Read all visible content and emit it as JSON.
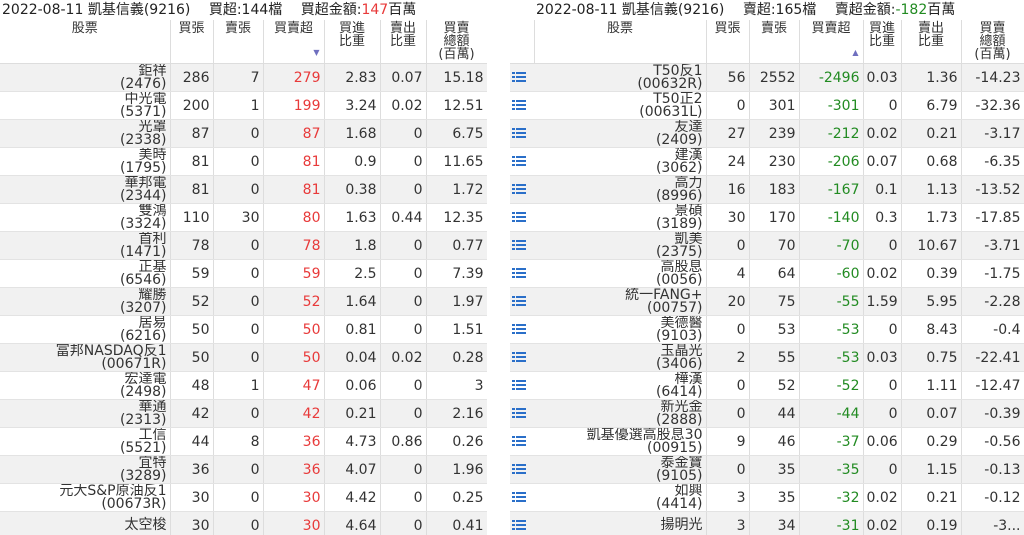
{
  "left": {
    "date": "2022-08-11",
    "broker": "凱基信義(9216)",
    "count_label": "買超:144檔",
    "amount_prefix": "買超金額:",
    "amount_value": "147",
    "amount_unit": "百萬",
    "headers": [
      "股票",
      "買張",
      "賣張",
      "買賣超",
      "買進\n比重",
      "賣出\n比重",
      "買賣\n總額\n(百萬)"
    ],
    "sort_indicator": "▼",
    "rows": [
      {
        "name": "鉅祥",
        "code": "(2476)",
        "buy": "286",
        "sell": "7",
        "net": "279",
        "buy_ratio": "2.83",
        "sell_ratio": "0.07",
        "total": "15.18"
      },
      {
        "name": "中光電",
        "code": "(5371)",
        "buy": "200",
        "sell": "1",
        "net": "199",
        "buy_ratio": "3.24",
        "sell_ratio": "0.02",
        "total": "12.51"
      },
      {
        "name": "光罩",
        "code": "(2338)",
        "buy": "87",
        "sell": "0",
        "net": "87",
        "buy_ratio": "1.68",
        "sell_ratio": "0",
        "total": "6.75"
      },
      {
        "name": "美時",
        "code": "(1795)",
        "buy": "81",
        "sell": "0",
        "net": "81",
        "buy_ratio": "0.9",
        "sell_ratio": "0",
        "total": "11.65"
      },
      {
        "name": "華邦電",
        "code": "(2344)",
        "buy": "81",
        "sell": "0",
        "net": "81",
        "buy_ratio": "0.38",
        "sell_ratio": "0",
        "total": "1.72"
      },
      {
        "name": "雙鴻",
        "code": "(3324)",
        "buy": "110",
        "sell": "30",
        "net": "80",
        "buy_ratio": "1.63",
        "sell_ratio": "0.44",
        "total": "12.35"
      },
      {
        "name": "首利",
        "code": "(1471)",
        "buy": "78",
        "sell": "0",
        "net": "78",
        "buy_ratio": "1.8",
        "sell_ratio": "0",
        "total": "0.77"
      },
      {
        "name": "正基",
        "code": "(6546)",
        "buy": "59",
        "sell": "0",
        "net": "59",
        "buy_ratio": "2.5",
        "sell_ratio": "0",
        "total": "7.39"
      },
      {
        "name": "耀勝",
        "code": "(3207)",
        "buy": "52",
        "sell": "0",
        "net": "52",
        "buy_ratio": "1.64",
        "sell_ratio": "0",
        "total": "1.97"
      },
      {
        "name": "居易",
        "code": "(6216)",
        "buy": "50",
        "sell": "0",
        "net": "50",
        "buy_ratio": "0.81",
        "sell_ratio": "0",
        "total": "1.51"
      },
      {
        "name": "富邦NASDAQ反1",
        "code": "(00671R)",
        "buy": "50",
        "sell": "0",
        "net": "50",
        "buy_ratio": "0.04",
        "sell_ratio": "0.02",
        "total": "0.28"
      },
      {
        "name": "宏達電",
        "code": "(2498)",
        "buy": "48",
        "sell": "1",
        "net": "47",
        "buy_ratio": "0.06",
        "sell_ratio": "0",
        "total": "3"
      },
      {
        "name": "華通",
        "code": "(2313)",
        "buy": "42",
        "sell": "0",
        "net": "42",
        "buy_ratio": "0.21",
        "sell_ratio": "0",
        "total": "2.16"
      },
      {
        "name": "工信",
        "code": "(5521)",
        "buy": "44",
        "sell": "8",
        "net": "36",
        "buy_ratio": "4.73",
        "sell_ratio": "0.86",
        "total": "0.26"
      },
      {
        "name": "宜特",
        "code": "(3289)",
        "buy": "36",
        "sell": "0",
        "net": "36",
        "buy_ratio": "4.07",
        "sell_ratio": "0",
        "total": "1.96"
      },
      {
        "name": "元大S&P原油反1",
        "code": "(00673R)",
        "buy": "30",
        "sell": "0",
        "net": "30",
        "buy_ratio": "4.42",
        "sell_ratio": "0",
        "total": "0.25"
      },
      {
        "name": "太空梭",
        "code": "",
        "buy": "30",
        "sell": "0",
        "net": "30",
        "buy_ratio": "4.64",
        "sell_ratio": "0",
        "total": "0.41"
      }
    ]
  },
  "right": {
    "date": "2022-08-11",
    "broker": "凱基信義(9216)",
    "count_label": "賣超:165檔",
    "amount_prefix": "賣超金額:",
    "amount_value": "-182",
    "amount_unit": "百萬",
    "headers": [
      "股票",
      "買張",
      "賣張",
      "買賣超",
      "買進\n比重",
      "賣出\n比重",
      "買賣\n總額\n(百萬)"
    ],
    "sort_indicator": "▲",
    "row_icon": "list-icon",
    "rows": [
      {
        "name": "T50反1",
        "code": "(00632R)",
        "buy": "56",
        "sell": "2552",
        "net": "-2496",
        "buy_ratio": "0.03",
        "sell_ratio": "1.36",
        "total": "-14.23"
      },
      {
        "name": "T50正2",
        "code": "(00631L)",
        "buy": "0",
        "sell": "301",
        "net": "-301",
        "buy_ratio": "0",
        "sell_ratio": "6.79",
        "total": "-32.36"
      },
      {
        "name": "友達",
        "code": "(2409)",
        "buy": "27",
        "sell": "239",
        "net": "-212",
        "buy_ratio": "0.02",
        "sell_ratio": "0.21",
        "total": "-3.17"
      },
      {
        "name": "建漢",
        "code": "(3062)",
        "buy": "24",
        "sell": "230",
        "net": "-206",
        "buy_ratio": "0.07",
        "sell_ratio": "0.68",
        "total": "-6.35"
      },
      {
        "name": "高力",
        "code": "(8996)",
        "buy": "16",
        "sell": "183",
        "net": "-167",
        "buy_ratio": "0.1",
        "sell_ratio": "1.13",
        "total": "-13.52"
      },
      {
        "name": "景碩",
        "code": "(3189)",
        "buy": "30",
        "sell": "170",
        "net": "-140",
        "buy_ratio": "0.3",
        "sell_ratio": "1.73",
        "total": "-17.85"
      },
      {
        "name": "凱美",
        "code": "(2375)",
        "buy": "0",
        "sell": "70",
        "net": "-70",
        "buy_ratio": "0",
        "sell_ratio": "10.67",
        "total": "-3.71"
      },
      {
        "name": "高股息",
        "code": "(0056)",
        "buy": "4",
        "sell": "64",
        "net": "-60",
        "buy_ratio": "0.02",
        "sell_ratio": "0.39",
        "total": "-1.75"
      },
      {
        "name": "統一FANG+",
        "code": "(00757)",
        "buy": "20",
        "sell": "75",
        "net": "-55",
        "buy_ratio": "1.59",
        "sell_ratio": "5.95",
        "total": "-2.28"
      },
      {
        "name": "美德醫",
        "code": "(9103)",
        "buy": "0",
        "sell": "53",
        "net": "-53",
        "buy_ratio": "0",
        "sell_ratio": "8.43",
        "total": "-0.4"
      },
      {
        "name": "玉晶光",
        "code": "(3406)",
        "buy": "2",
        "sell": "55",
        "net": "-53",
        "buy_ratio": "0.03",
        "sell_ratio": "0.75",
        "total": "-22.41"
      },
      {
        "name": "樺漢",
        "code": "(6414)",
        "buy": "0",
        "sell": "52",
        "net": "-52",
        "buy_ratio": "0",
        "sell_ratio": "1.11",
        "total": "-12.47"
      },
      {
        "name": "新光金",
        "code": "(2888)",
        "buy": "0",
        "sell": "44",
        "net": "-44",
        "buy_ratio": "0",
        "sell_ratio": "0.07",
        "total": "-0.39"
      },
      {
        "name": "凱基優選高股息30",
        "code": "(00915)",
        "buy": "9",
        "sell": "46",
        "net": "-37",
        "buy_ratio": "0.06",
        "sell_ratio": "0.29",
        "total": "-0.56"
      },
      {
        "name": "泰金寶",
        "code": "(9105)",
        "buy": "0",
        "sell": "35",
        "net": "-35",
        "buy_ratio": "0",
        "sell_ratio": "1.15",
        "total": "-0.13"
      },
      {
        "name": "如興",
        "code": "(4414)",
        "buy": "3",
        "sell": "35",
        "net": "-32",
        "buy_ratio": "0.02",
        "sell_ratio": "0.21",
        "total": "-0.12"
      },
      {
        "name": "揚明光",
        "code": "",
        "buy": "3",
        "sell": "34",
        "net": "-31",
        "buy_ratio": "0.02",
        "sell_ratio": "0.19",
        "total": "-3..."
      }
    ]
  }
}
